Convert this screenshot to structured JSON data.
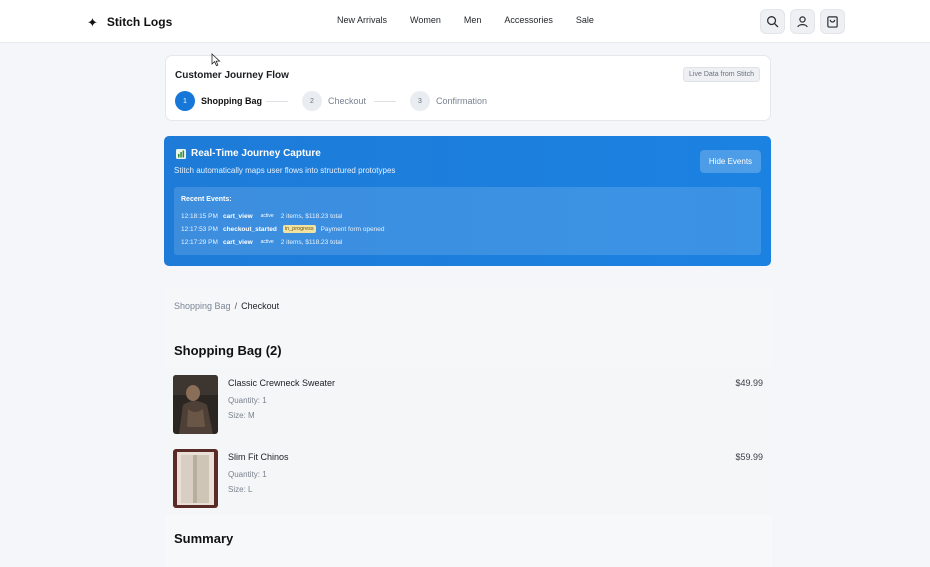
{
  "header": {
    "brand": "Stitch Logs",
    "brand_icon": "sparkle-icon",
    "nav": [
      "New Arrivals",
      "Women",
      "Men",
      "Accessories",
      "Sale"
    ],
    "icons": [
      "search-icon",
      "user-icon",
      "bag-icon"
    ]
  },
  "journey": {
    "title": "Customer Journey Flow",
    "badge": "Live Data from Stitch",
    "steps": [
      {
        "num": "1",
        "label": "Shopping Bag",
        "state": "active"
      },
      {
        "num": "2",
        "label": "Checkout",
        "state": "inactive"
      },
      {
        "num": "3",
        "label": "Confirmation",
        "state": "inactive"
      }
    ]
  },
  "capture": {
    "title": "Real-Time Journey Capture",
    "subtitle": "Stitch automatically maps user flows into structured prototypes",
    "hide_button": "Hide Events",
    "events_title": "Recent Events:",
    "events": [
      {
        "time": "12:18:15 PM",
        "name": "cart_view",
        "status": "active",
        "detail": "2 items, $118.23 total"
      },
      {
        "time": "12:17:53 PM",
        "name": "checkout_started",
        "status": "in_progress",
        "detail": "Payment form opened"
      },
      {
        "time": "12:17:29 PM",
        "name": "cart_view",
        "status": "active",
        "detail": "2 items, $118.23 total"
      }
    ],
    "colors": {
      "banner": "#1e7bd8",
      "in_progress": "#f2e3a0"
    }
  },
  "cart": {
    "breadcrumb": {
      "link": "Shopping Bag",
      "separator": "/",
      "current": "Checkout"
    },
    "title": "Shopping Bag (2)",
    "items": [
      {
        "name": "Classic Crewneck Sweater",
        "quantity": "Quantity: 1",
        "size": "Size: M",
        "price": "$49.99"
      },
      {
        "name": "Slim Fit Chinos",
        "quantity": "Quantity: 1",
        "size": "Size: L",
        "price": "$59.99"
      }
    ],
    "summary_title": "Summary"
  },
  "accent": "#1677d9"
}
